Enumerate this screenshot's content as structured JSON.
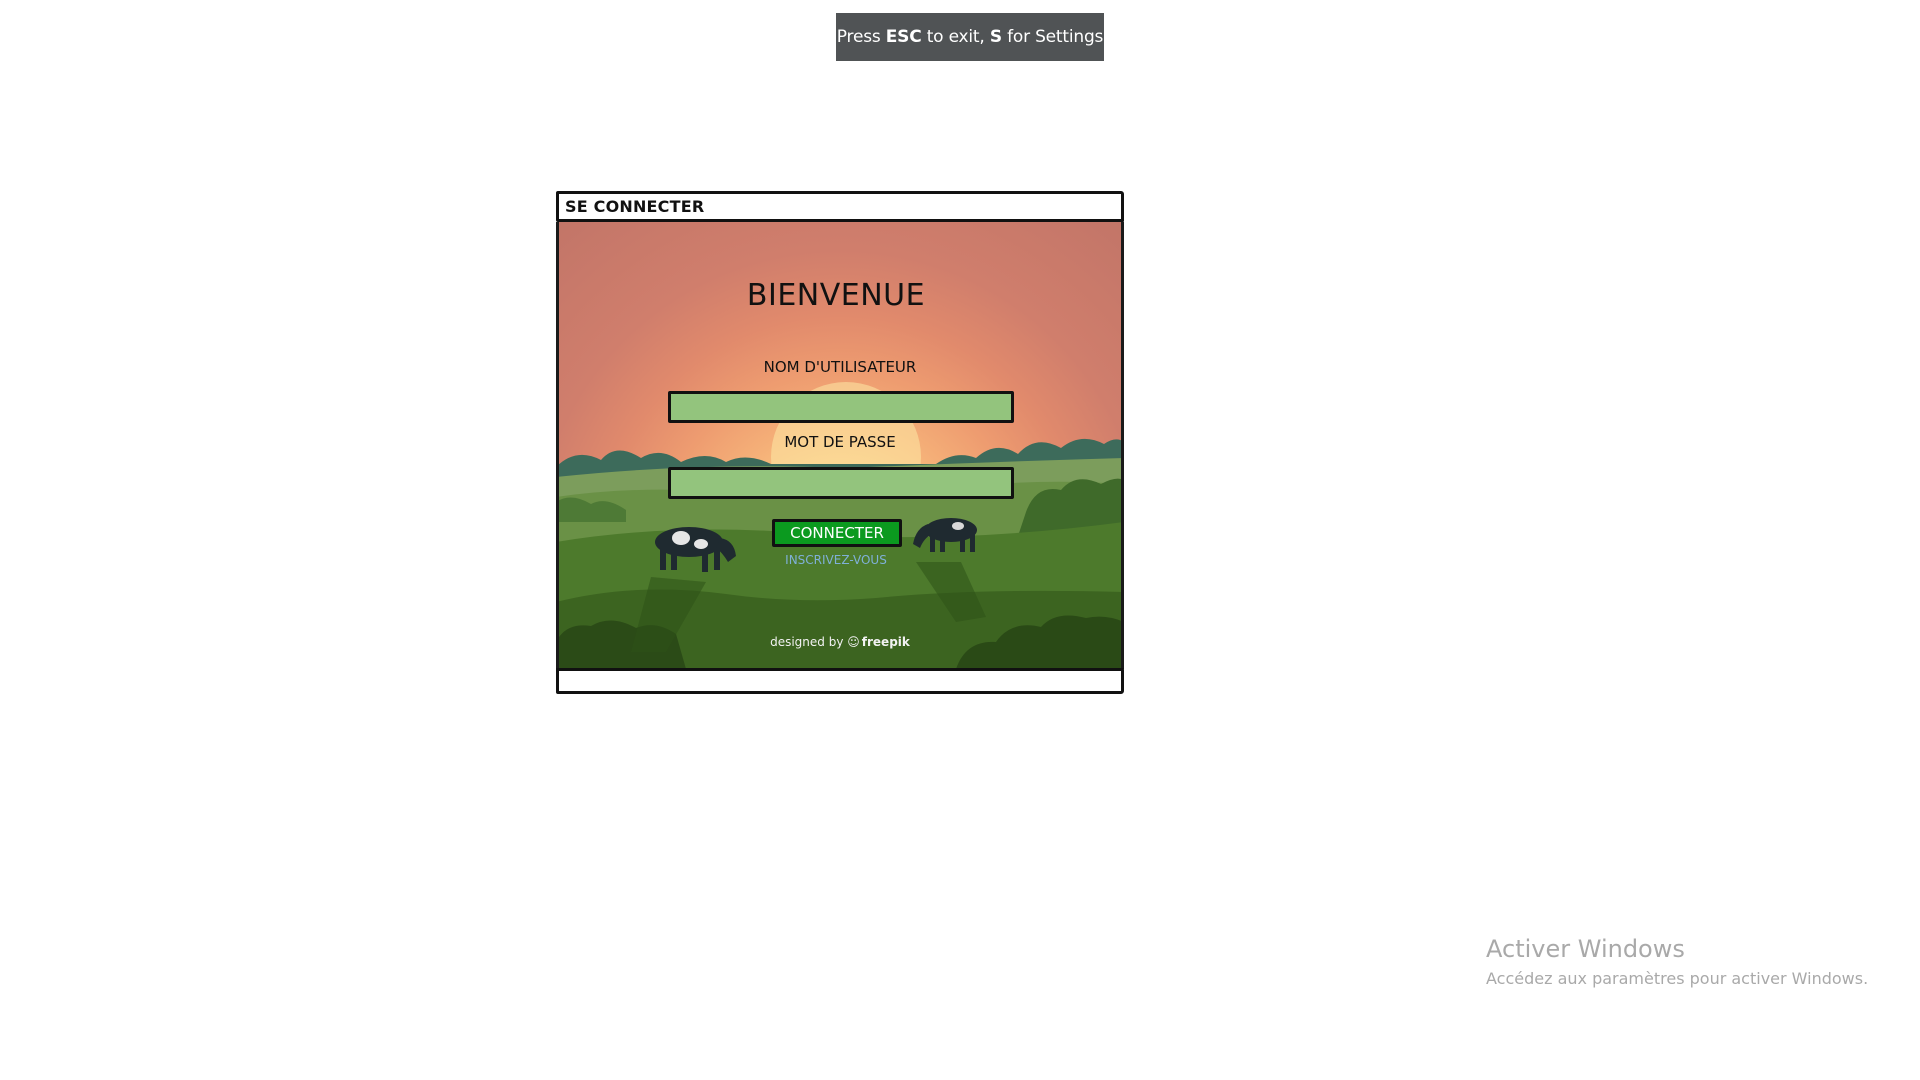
{
  "overlay": {
    "press": "Press",
    "esc_key": "ESC",
    "esc_text": "to exit,",
    "s_key": "S",
    "s_text": "for Settings"
  },
  "window": {
    "title": "SE CONNECTER",
    "welcome": "BIENVENUE",
    "username_label": "NOM D'UTILISATEUR",
    "username_value": "",
    "password_label": "MOT DE PASSE",
    "password_value": "",
    "connect_button": "CONNECTER",
    "register_link": "INSCRIVEZ-VOUS",
    "credit_prefix": "designed by",
    "credit_brand": "freepik"
  },
  "windows_activation": {
    "title": "Activer Windows",
    "subtitle": "Accédez aux paramètres pour activer Windows."
  },
  "colors": {
    "field_fill": "#93c47d",
    "button_fill": "#0b9a1f",
    "link_color": "#7fb0d8"
  }
}
